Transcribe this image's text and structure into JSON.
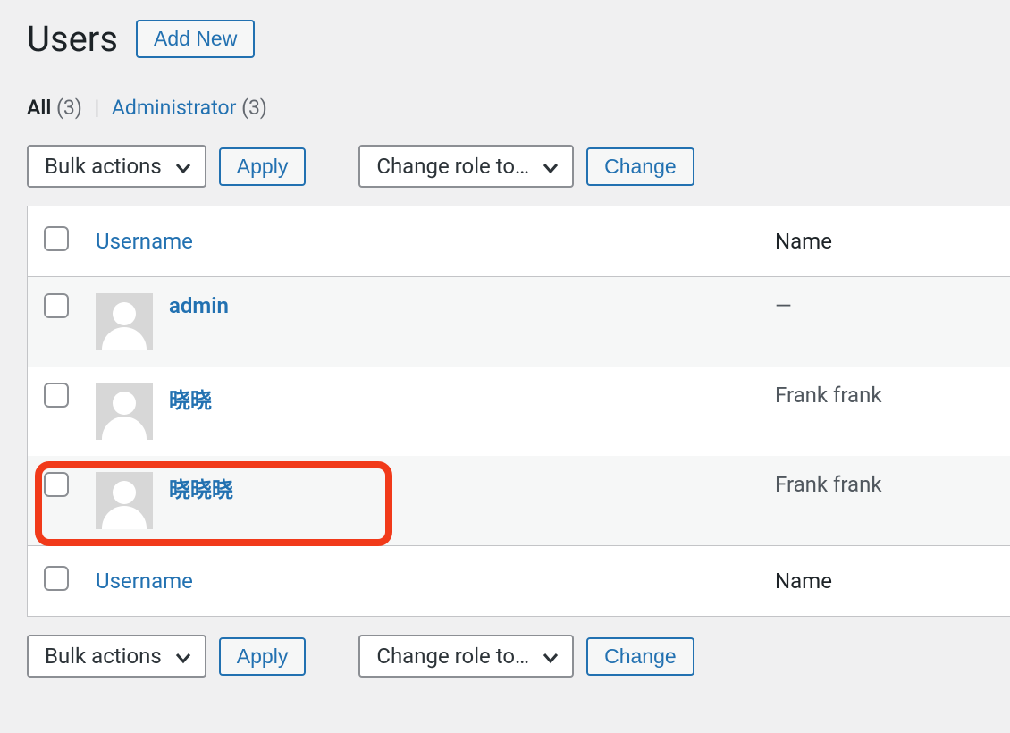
{
  "header": {
    "title": "Users",
    "add_new_label": "Add New"
  },
  "filters": {
    "all_label": "All",
    "all_count": "(3)",
    "separator": "|",
    "admin_label": "Administrator",
    "admin_count": "(3)"
  },
  "actions": {
    "bulk_label": "Bulk actions",
    "apply_label": "Apply",
    "change_role_label": "Change role to…",
    "change_label": "Change"
  },
  "table": {
    "col_username": "Username",
    "col_name": "Name",
    "rows": [
      {
        "username": "admin",
        "name": "—",
        "highlighted": false
      },
      {
        "username": "晓晓",
        "name": "Frank frank",
        "highlighted": false
      },
      {
        "username": "晓晓晓",
        "name": "Frank frank",
        "highlighted": true
      }
    ]
  }
}
